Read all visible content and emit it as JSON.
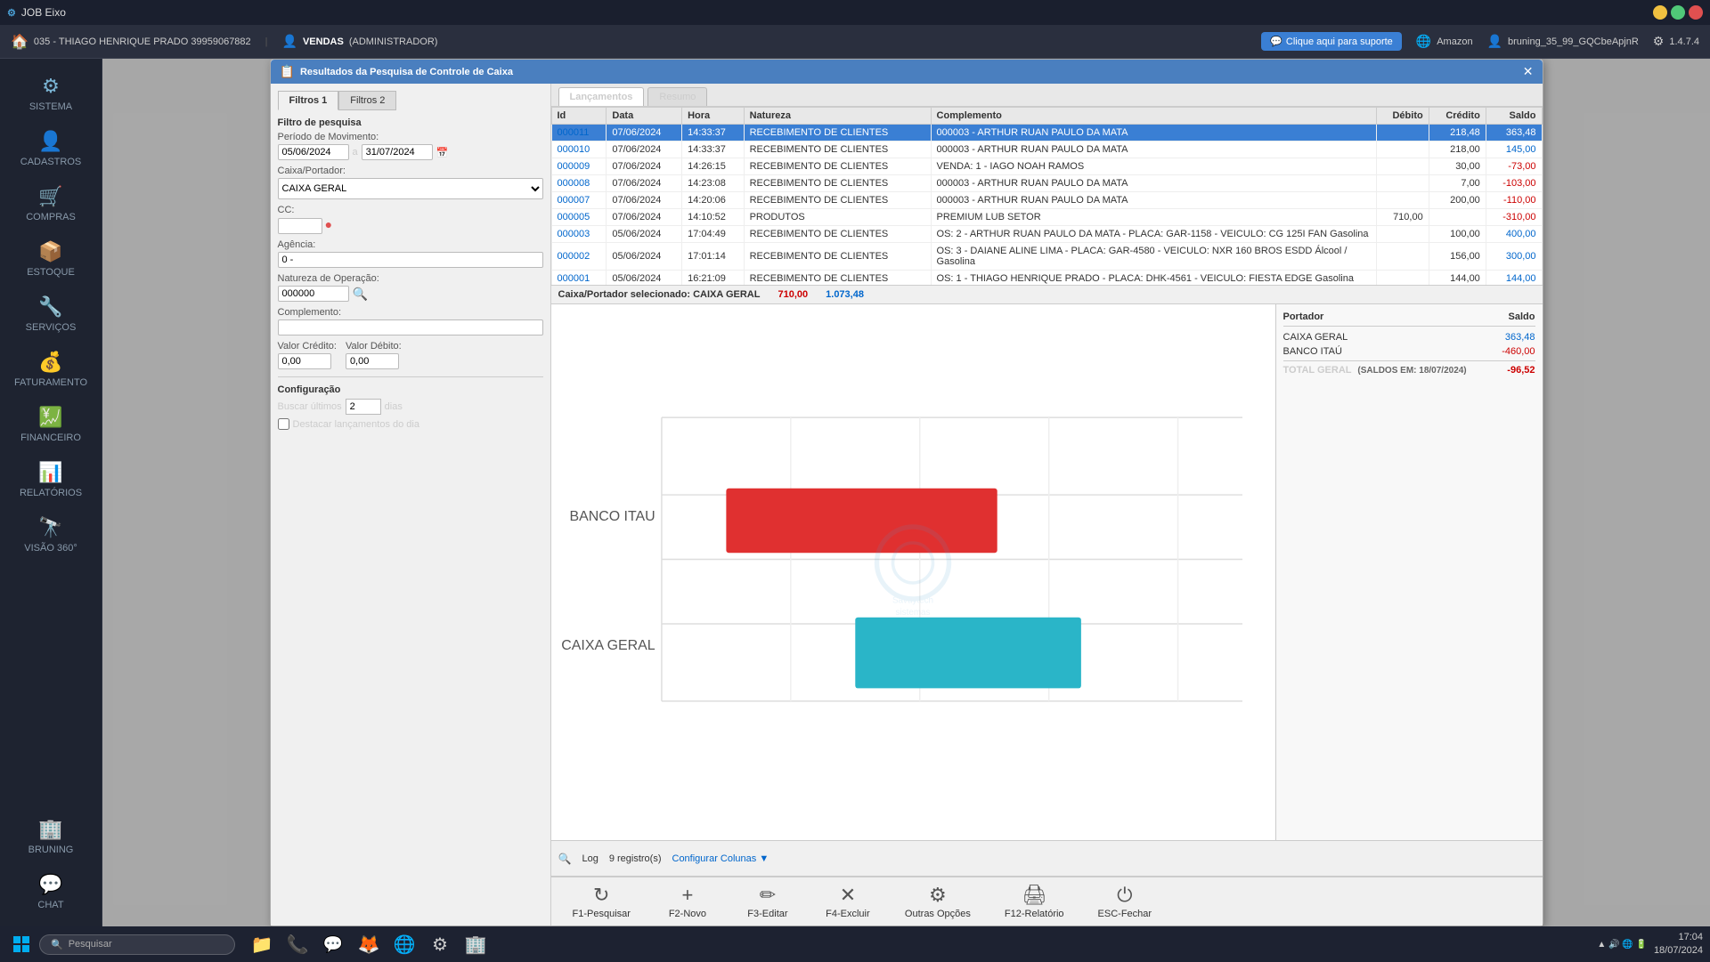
{
  "titlebar": {
    "app_name": "JOB Eixo",
    "min_btn": "−",
    "max_btn": "□",
    "close_btn": "✕"
  },
  "topnav": {
    "store": "035 - THIAGO HENRIQUE PRADO 39959067882",
    "module": "VENDAS",
    "role": "(ADMINISTRADOR)",
    "support_label": "Clique aqui para suporte",
    "amazon_label": "Amazon",
    "user_label": "bruning_35_99_GQCbeApjnR",
    "version": "1.4.7.4"
  },
  "sidebar": {
    "items": [
      {
        "id": "sistema",
        "label": "SISTEMA",
        "icon": "⚙"
      },
      {
        "id": "cadastros",
        "label": "CADASTROS",
        "icon": "👤"
      },
      {
        "id": "compras",
        "label": "COMPRAS",
        "icon": "🛒"
      },
      {
        "id": "estoque",
        "label": "ESTOQUE",
        "icon": "📦"
      },
      {
        "id": "servicos",
        "label": "SERVIÇOS",
        "icon": "🔧"
      },
      {
        "id": "faturamento",
        "label": "FATURAMENTO",
        "icon": "💰"
      },
      {
        "id": "financeiro",
        "label": "FINANCEIRO",
        "icon": "💹"
      },
      {
        "id": "relatorios",
        "label": "RELATÓRIOS",
        "icon": "📊"
      },
      {
        "id": "visao360",
        "label": "VISÃO 360°",
        "icon": "🔭"
      }
    ],
    "bottom_items": [
      {
        "id": "bruning",
        "label": "BRUNING",
        "icon": "🏢"
      },
      {
        "id": "chat",
        "label": "CHAT",
        "icon": "💬"
      }
    ]
  },
  "modal": {
    "title": "Resultados da Pesquisa de Controle de Caixa",
    "close_btn": "✕",
    "filter_tabs": [
      "Filtros 1",
      "Filtros 2"
    ],
    "active_filter_tab": "Filtros 1",
    "filter_section_label": "Filtro de pesquisa",
    "periodo": {
      "label": "Período de Movimento:",
      "from": "05/06/2024",
      "to": "31/07/2024"
    },
    "caixa": {
      "label": "Caixa/Portador:",
      "value": "CAIXA GERAL"
    },
    "cc": {
      "label": "CC:",
      "value": ""
    },
    "agencia": {
      "label": "Agência:",
      "value": "0 -"
    },
    "natureza_op": {
      "label": "Natureza de Operação:",
      "value": "000000"
    },
    "complemento": {
      "label": "Complemento:",
      "value": ""
    },
    "valor_credito": {
      "label": "Valor Crédito:",
      "value": "0,00"
    },
    "valor_debito": {
      "label": "Valor Débito:",
      "value": "0,00"
    },
    "config": {
      "label": "Configuração",
      "buscar_label": "Buscar últimos",
      "buscar_value": "2",
      "dias_label": "dias",
      "destacar_label": "Destacar lançamentos do dia"
    }
  },
  "results_tabs": [
    "Lançamentos",
    "Resumo"
  ],
  "table": {
    "headers": [
      "Id",
      "Data",
      "Hora",
      "Natureza",
      "Complemento",
      "Débito",
      "Crédito",
      "Saldo"
    ],
    "rows": [
      {
        "id": "000011",
        "data": "07/06/2024",
        "hora": "14:33:37",
        "natureza": "RECEBIMENTO DE CLIENTES",
        "complemento": "000003 - ARTHUR RUAN PAULO DA MATA",
        "debito": "",
        "credito": "218,48",
        "saldo": "363,48",
        "selected": true
      },
      {
        "id": "000010",
        "data": "07/06/2024",
        "hora": "14:33:37",
        "natureza": "RECEBIMENTO DE CLIENTES",
        "complemento": "000003 - ARTHUR RUAN PAULO DA MATA",
        "debito": "",
        "credito": "218,00",
        "saldo": "145,00",
        "selected": false
      },
      {
        "id": "000009",
        "data": "07/06/2024",
        "hora": "14:26:15",
        "natureza": "RECEBIMENTO DE CLIENTES",
        "complemento": "VENDA: 1 - IAGO NOAH RAMOS",
        "debito": "",
        "credito": "30,00",
        "saldo": "-73,00",
        "selected": false
      },
      {
        "id": "000008",
        "data": "07/06/2024",
        "hora": "14:23:08",
        "natureza": "RECEBIMENTO DE CLIENTES",
        "complemento": "000003 - ARTHUR RUAN PAULO DA MATA",
        "debito": "",
        "credito": "7,00",
        "saldo": "-103,00",
        "selected": false
      },
      {
        "id": "000007",
        "data": "07/06/2024",
        "hora": "14:20:06",
        "natureza": "RECEBIMENTO DE CLIENTES",
        "complemento": "000003 - ARTHUR RUAN PAULO DA MATA",
        "debito": "",
        "credito": "200,00",
        "saldo": "-110,00",
        "selected": false
      },
      {
        "id": "000005",
        "data": "07/06/2024",
        "hora": "14:10:52",
        "natureza": "PRODUTOS",
        "complemento": "PREMIUM LUB SETOR",
        "debito": "710,00",
        "credito": "",
        "saldo": "-310,00",
        "selected": false
      },
      {
        "id": "000003",
        "data": "05/06/2024",
        "hora": "17:04:49",
        "natureza": "RECEBIMENTO DE CLIENTES",
        "complemento": "OS: 2 - ARTHUR RUAN PAULO DA MATA - PLACA: GAR-1158 - VEICULO: CG 125I FAN Gasolina",
        "debito": "",
        "credito": "100,00",
        "saldo": "400,00",
        "selected": false
      },
      {
        "id": "000002",
        "data": "05/06/2024",
        "hora": "17:01:14",
        "natureza": "RECEBIMENTO DE CLIENTES",
        "complemento": "OS: 3 - DAIANE ALINE LIMA - PLACA: GAR-4580 - VEICULO: NXR 160 BROS ESDD Álcool / Gasolina",
        "debito": "",
        "credito": "156,00",
        "saldo": "300,00",
        "selected": false
      },
      {
        "id": "000001",
        "data": "05/06/2024",
        "hora": "16:21:09",
        "natureza": "RECEBIMENTO DE CLIENTES",
        "complemento": "OS: 1 - THIAGO HENRIQUE PRADO - PLACA: DHK-4561 - VEICULO: FIESTA EDGE Gasolina",
        "debito": "",
        "credito": "144,00",
        "saldo": "144,00",
        "selected": false
      }
    ]
  },
  "caixa_bar": {
    "label": "Caixa/Portador selecionado: CAIXA GERAL",
    "debito_total": "710,00",
    "credito_total": "1.073,48"
  },
  "portador": {
    "header_portador": "Portador",
    "header_saldo": "Saldo",
    "rows": [
      {
        "name": "CAIXA GERAL",
        "saldo": "363,48",
        "positive": true
      },
      {
        "name": "BANCO ITAÚ",
        "saldo": "-460,00",
        "positive": false
      }
    ],
    "total_label": "TOTAL GERAL",
    "total_date": "(SALDOS EM: 18/07/2024)",
    "total_saldo": "-96,52"
  },
  "chart": {
    "banco_itau_label": "BANCO ITAU",
    "caixa_geral_label": "CAIXA GERAL",
    "banco_itau_value": -460,
    "caixa_geral_value": 363.48
  },
  "footer_buttons": [
    {
      "key": "F1",
      "label": "F1-Pesquisar",
      "icon": "↻"
    },
    {
      "key": "F2",
      "label": "F2-Novo",
      "icon": "+"
    },
    {
      "key": "F3",
      "label": "F3-Editar",
      "icon": "✏"
    },
    {
      "key": "F4",
      "label": "F4-Excluir",
      "icon": "✕"
    },
    {
      "key": "outras",
      "label": "Outras Opções",
      "icon": "⚙"
    },
    {
      "key": "F12",
      "label": "F12-Relatório",
      "icon": "🖨"
    },
    {
      "key": "ESC",
      "label": "ESC-Fechar",
      "icon": "⏻"
    }
  ],
  "status_bar": {
    "log_label": "Log",
    "records_label": "9 registro(s)",
    "config_label": "Configurar Colunas ▼"
  },
  "taskbar": {
    "search_placeholder": "Pesquisar",
    "time": "17:04",
    "date": "18/07/2024"
  }
}
